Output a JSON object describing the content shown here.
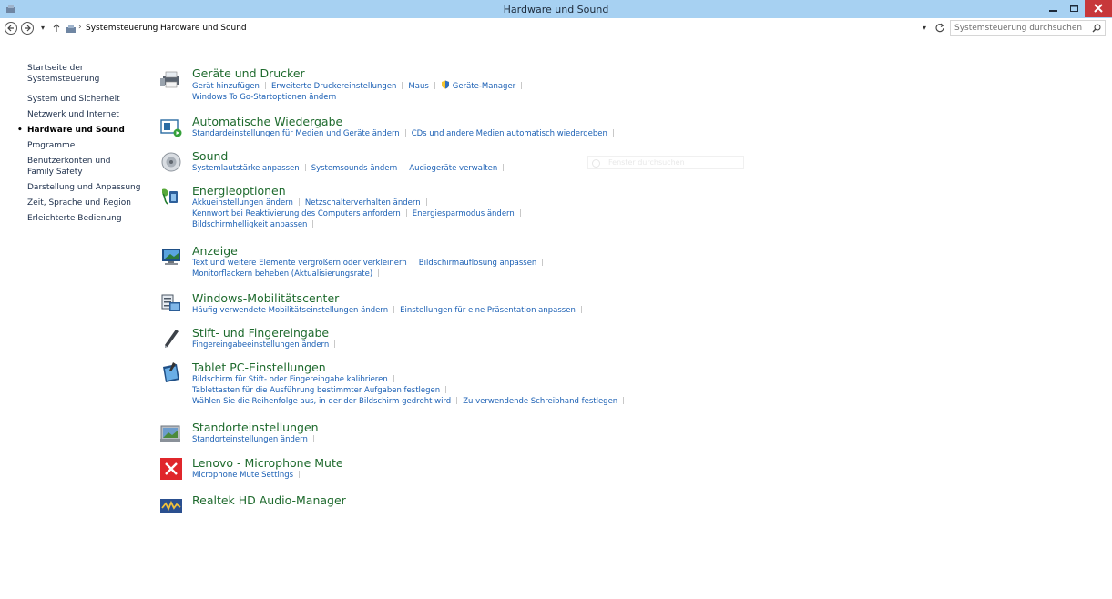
{
  "window": {
    "title": "Hardware und Sound"
  },
  "address": {
    "breadcrumbs": [
      "Systemsteuerung",
      "Hardware und Sound"
    ],
    "search_placeholder": "Systemsteuerung durchsuchen"
  },
  "sidebar": {
    "items": [
      {
        "label": "Startseite der Systemsteuerung"
      },
      {
        "label": "System und Sicherheit"
      },
      {
        "label": "Netzwerk und Internet"
      },
      {
        "label": "Hardware und Sound",
        "active": true
      },
      {
        "label": "Programme"
      },
      {
        "label": "Benutzerkonten und Family Safety"
      },
      {
        "label": "Darstellung und Anpassung"
      },
      {
        "label": "Zeit, Sprache und Region"
      },
      {
        "label": "Erleichterte Bedienung"
      }
    ]
  },
  "ghost_search": {
    "placeholder": "Fenster durchsuchen"
  },
  "categories": [
    {
      "title": "Geräte und Drucker",
      "icon": "printer-icon",
      "task_lines": [
        [
          "Gerät hinzufügen",
          "Erweiterte Druckereinstellungen",
          "Maus",
          "Geräte-Manager"
        ],
        [
          "Windows To Go-Startoptionen ändern"
        ]
      ]
    },
    {
      "title": "Automatische Wiedergabe",
      "icon": "autoplay-icon",
      "task_lines": [
        [
          "Standardeinstellungen für Medien und Geräte ändern",
          "CDs und andere Medien automatisch wiedergeben"
        ]
      ]
    },
    {
      "title": "Sound",
      "icon": "speaker-icon",
      "task_lines": [
        [
          "Systemlautstärke anpassen",
          "Systemsounds ändern",
          "Audiogeräte verwalten"
        ]
      ]
    },
    {
      "title": "Energieoptionen",
      "icon": "power-options-icon",
      "task_lines": [
        [
          "Akkueinstellungen ändern",
          "Netzschalterverhalten ändern"
        ],
        [
          "Kennwort bei Reaktivierung des Computers anfordern",
          "Energiesparmodus ändern"
        ],
        [
          "Bildschirmhelligkeit anpassen"
        ]
      ]
    },
    {
      "title": "Anzeige",
      "icon": "display-icon",
      "task_lines": [
        [
          "Text und weitere Elemente vergrößern oder verkleinern",
          "Bildschirmauflösung anpassen"
        ],
        [
          "Monitorflackern beheben (Aktualisierungsrate)"
        ]
      ]
    },
    {
      "title": "Windows-Mobilitätscenter",
      "icon": "mobility-center-icon",
      "task_lines": [
        [
          "Häufig verwendete Mobilitätseinstellungen ändern",
          "Einstellungen für eine Präsentation anpassen"
        ]
      ]
    },
    {
      "title": "Stift- und Fingereingabe",
      "icon": "pen-icon",
      "task_lines": [
        [
          "Fingereingabeeinstellungen ändern"
        ]
      ]
    },
    {
      "title": "Tablet PC-Einstellungen",
      "icon": "tablet-icon",
      "task_lines": [
        [
          "Bildschirm für Stift- oder Fingereingabe kalibrieren"
        ],
        [
          "Tablettasten für die Ausführung bestimmter Aufgaben festlegen"
        ],
        [
          "Wählen Sie die Reihenfolge aus, in der der Bildschirm gedreht wird",
          "Zu verwendende Schreibhand festlegen"
        ]
      ]
    },
    {
      "title": "Standorteinstellungen",
      "icon": "location-icon",
      "task_lines": [
        [
          "Standorteinstellungen ändern"
        ]
      ]
    },
    {
      "title": "Lenovo - Microphone Mute",
      "icon": "microphone-mute-icon",
      "task_lines": [
        [
          "Microphone Mute Settings"
        ]
      ]
    },
    {
      "title": "Realtek HD Audio-Manager",
      "icon": "realtek-audio-icon",
      "task_lines": []
    }
  ]
}
